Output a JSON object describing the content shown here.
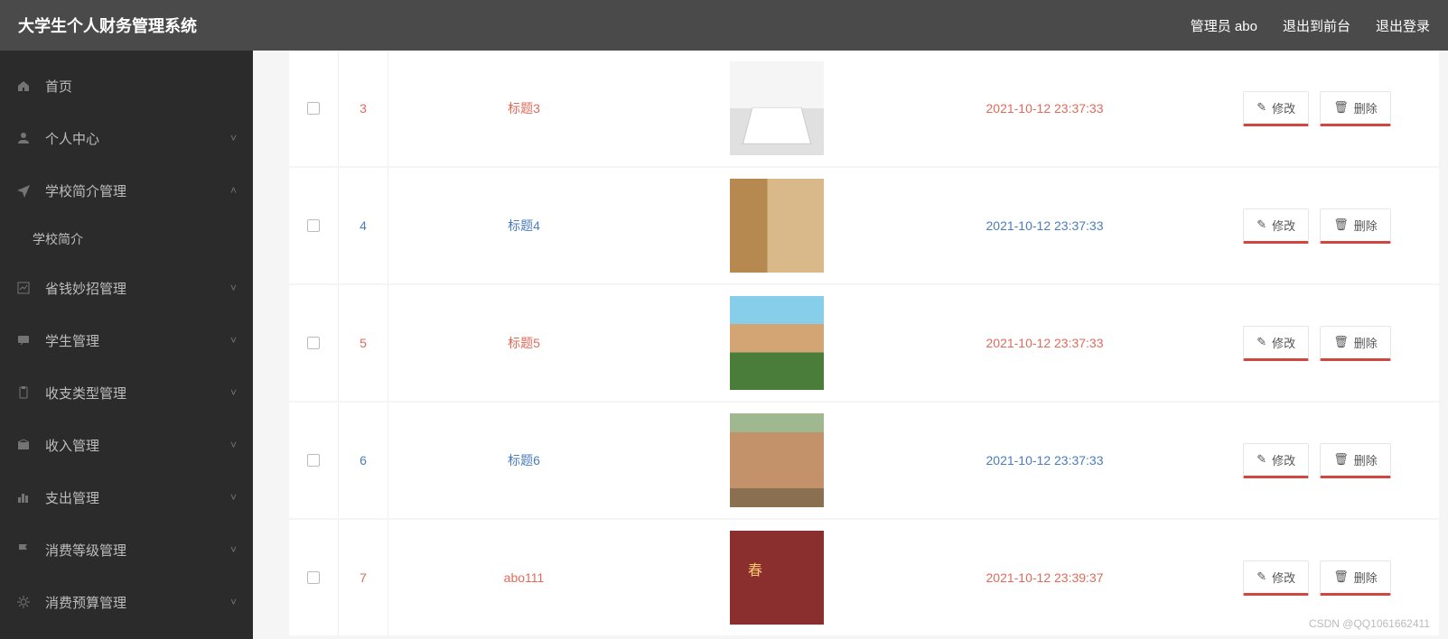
{
  "header": {
    "title": "大学生个人财务管理系统",
    "user_prefix": "管理员 abo",
    "exit_front": "退出到前台",
    "logout": "退出登录"
  },
  "sidebar": {
    "items": [
      {
        "label": "首页",
        "icon": "home"
      },
      {
        "label": "个人中心",
        "icon": "user",
        "chev": "down"
      },
      {
        "label": "学校简介管理",
        "icon": "send",
        "chev": "up"
      },
      {
        "label": "学校简介",
        "sub": true
      },
      {
        "label": "省钱妙招管理",
        "icon": "chart",
        "chev": "down"
      },
      {
        "label": "学生管理",
        "icon": "msg",
        "chev": "down"
      },
      {
        "label": "收支类型管理",
        "icon": "clip",
        "chev": "down"
      },
      {
        "label": "收入管理",
        "icon": "box",
        "chev": "down"
      },
      {
        "label": "支出管理",
        "icon": "bar",
        "chev": "down"
      },
      {
        "label": "消费等级管理",
        "icon": "flag",
        "chev": "down"
      },
      {
        "label": "消费预算管理",
        "icon": "gear",
        "chev": "down"
      }
    ]
  },
  "actions": {
    "edit": "修改",
    "delete": "删除"
  },
  "rows": [
    {
      "id": "3",
      "title": "标题3",
      "time": "2021-10-12 23:37:33",
      "alt": true,
      "thumb": "t3"
    },
    {
      "id": "4",
      "title": "标题4",
      "time": "2021-10-12 23:37:33",
      "alt": false,
      "thumb": "t4"
    },
    {
      "id": "5",
      "title": "标题5",
      "time": "2021-10-12 23:37:33",
      "alt": true,
      "thumb": "t5"
    },
    {
      "id": "6",
      "title": "标题6",
      "time": "2021-10-12 23:37:33",
      "alt": false,
      "thumb": "t6"
    },
    {
      "id": "7",
      "title": "abo111",
      "time": "2021-10-12 23:39:37",
      "alt": true,
      "thumb": "t7"
    }
  ],
  "watermark": "CSDN @QQ1061662411"
}
